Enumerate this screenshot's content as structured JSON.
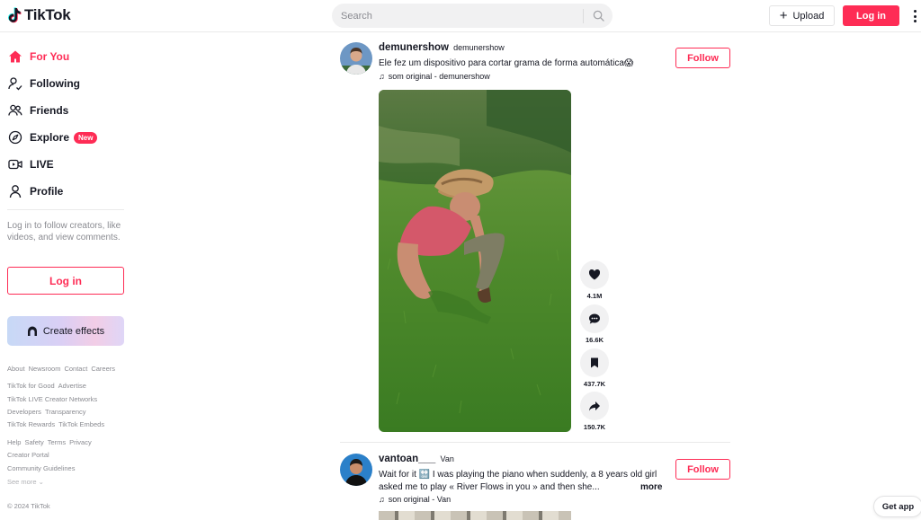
{
  "header": {
    "brand": "TikTok",
    "search_placeholder": "Search",
    "upload_label": "Upload",
    "login_label": "Log in"
  },
  "sidebar": {
    "nav": [
      {
        "label": "For You",
        "icon": "home-icon",
        "active": true
      },
      {
        "label": "Following",
        "icon": "following-icon"
      },
      {
        "label": "Friends",
        "icon": "friends-icon"
      },
      {
        "label": "Explore",
        "icon": "compass-icon",
        "badge": "New"
      },
      {
        "label": "LIVE",
        "icon": "live-icon"
      },
      {
        "label": "Profile",
        "icon": "profile-icon"
      }
    ],
    "login_note": "Log in to follow creators, like videos, and view comments.",
    "login_label": "Log in",
    "create_effects_label": "Create effects",
    "footer": {
      "row1": [
        "About",
        "Newsroom",
        "Contact",
        "Careers"
      ],
      "row2": [
        "TikTok for Good",
        "Advertise"
      ],
      "row3": [
        "TikTok LIVE Creator Networks"
      ],
      "row4": [
        "Developers",
        "Transparency"
      ],
      "row5": [
        "TikTok Rewards",
        "TikTok Embeds"
      ],
      "row6": [
        "Help",
        "Safety",
        "Terms",
        "Privacy"
      ],
      "row7": [
        "Creator Portal"
      ],
      "row8": [
        "Community Guidelines"
      ],
      "see_more": "See more ⌄",
      "copyright": "© 2024 TikTok"
    }
  },
  "posts": [
    {
      "username": "demunershow",
      "nickname": "demunershow",
      "caption": "Ele fez um dispositivo para cortar grama de forma automática😱",
      "sound": "som original - demunershow",
      "follow_label": "Follow",
      "likes": "4.1M",
      "comments": "16.6K",
      "saves": "437.7K",
      "shares": "150.7K"
    },
    {
      "username": "vantoan___",
      "nickname": "Van",
      "caption": "Wait for it 🔛 I was playing the piano when suddenly, a 8 years old girl asked me to play « River Flows in you » and then she...",
      "more_label": "more",
      "sound": "son original - Van",
      "follow_label": "Follow"
    }
  ],
  "get_app_label": "Get app",
  "colors": {
    "accent": "#fe2c55",
    "text": "#161823",
    "muted": "#8a8b91"
  }
}
